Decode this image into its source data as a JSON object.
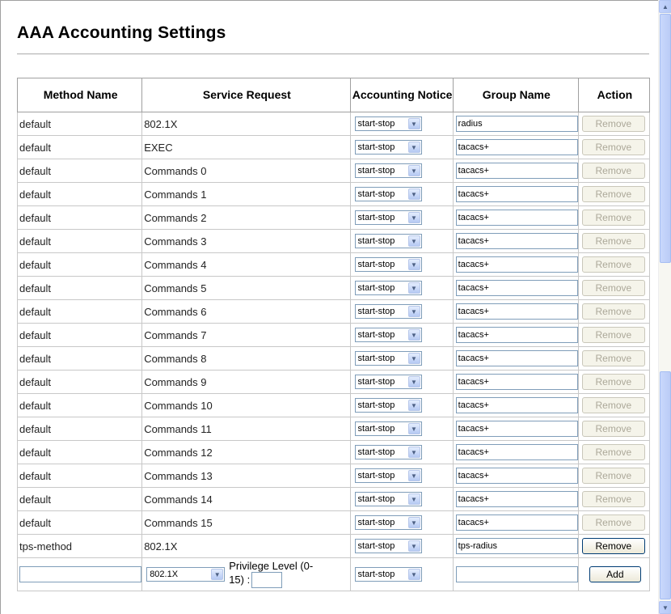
{
  "page": {
    "title": "AAA Accounting Settings"
  },
  "table": {
    "headers": {
      "method_name": "Method Name",
      "service_request": "Service Request",
      "accounting_notice": "Accounting Notice",
      "group_name": "Group Name",
      "action": "Action"
    },
    "rows": [
      {
        "method": "default",
        "service": "802.1X",
        "notice": "start-stop",
        "group": "radius",
        "action": "Remove"
      },
      {
        "method": "default",
        "service": "EXEC",
        "notice": "start-stop",
        "group": "tacacs+",
        "action": "Remove"
      },
      {
        "method": "default",
        "service": "Commands 0",
        "notice": "start-stop",
        "group": "tacacs+",
        "action": "Remove"
      },
      {
        "method": "default",
        "service": "Commands 1",
        "notice": "start-stop",
        "group": "tacacs+",
        "action": "Remove"
      },
      {
        "method": "default",
        "service": "Commands 2",
        "notice": "start-stop",
        "group": "tacacs+",
        "action": "Remove"
      },
      {
        "method": "default",
        "service": "Commands 3",
        "notice": "start-stop",
        "group": "tacacs+",
        "action": "Remove"
      },
      {
        "method": "default",
        "service": "Commands 4",
        "notice": "start-stop",
        "group": "tacacs+",
        "action": "Remove"
      },
      {
        "method": "default",
        "service": "Commands 5",
        "notice": "start-stop",
        "group": "tacacs+",
        "action": "Remove"
      },
      {
        "method": "default",
        "service": "Commands 6",
        "notice": "start-stop",
        "group": "tacacs+",
        "action": "Remove"
      },
      {
        "method": "default",
        "service": "Commands 7",
        "notice": "start-stop",
        "group": "tacacs+",
        "action": "Remove"
      },
      {
        "method": "default",
        "service": "Commands 8",
        "notice": "start-stop",
        "group": "tacacs+",
        "action": "Remove"
      },
      {
        "method": "default",
        "service": "Commands 9",
        "notice": "start-stop",
        "group": "tacacs+",
        "action": "Remove"
      },
      {
        "method": "default",
        "service": "Commands 10",
        "notice": "start-stop",
        "group": "tacacs+",
        "action": "Remove"
      },
      {
        "method": "default",
        "service": "Commands 11",
        "notice": "start-stop",
        "group": "tacacs+",
        "action": "Remove"
      },
      {
        "method": "default",
        "service": "Commands 12",
        "notice": "start-stop",
        "group": "tacacs+",
        "action": "Remove"
      },
      {
        "method": "default",
        "service": "Commands 13",
        "notice": "start-stop",
        "group": "tacacs+",
        "action": "Remove"
      },
      {
        "method": "default",
        "service": "Commands 14",
        "notice": "start-stop",
        "group": "tacacs+",
        "action": "Remove"
      },
      {
        "method": "default",
        "service": "Commands 15",
        "notice": "start-stop",
        "group": "tacacs+",
        "action": "Remove"
      },
      {
        "method": "tps-method",
        "service": "802.1X",
        "notice": "start-stop",
        "group": "tps-radius",
        "action": "Remove"
      }
    ],
    "add_row": {
      "method_value": "",
      "service_value": "802.1X",
      "privilege_label_line1": "Privilege Level (0-",
      "privilege_label_line2": "15) :",
      "privilege_value": "",
      "notice_value": "start-stop",
      "group_value": "",
      "add_label": "Add"
    }
  }
}
